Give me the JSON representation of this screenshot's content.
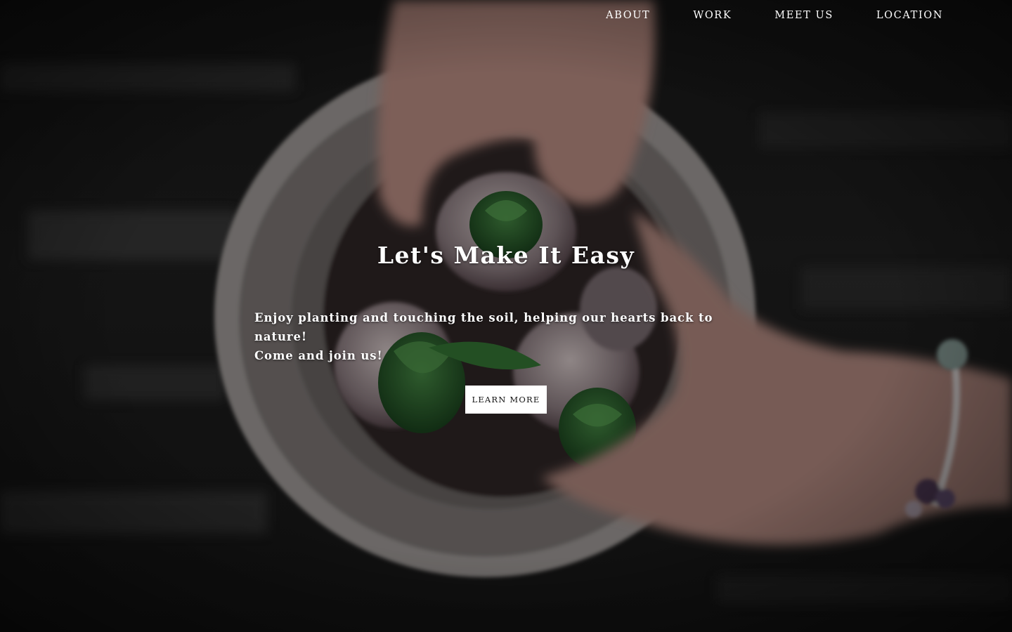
{
  "nav": {
    "items": [
      {
        "label": "ABOUT"
      },
      {
        "label": "WORK"
      },
      {
        "label": "MEET US"
      },
      {
        "label": "LOCATION"
      }
    ]
  },
  "hero": {
    "title": "Let's Make It Easy",
    "line1": "Enjoy planting and touching the soil, helping our hearts back to nature!",
    "line2": "Come and join us!",
    "cta_label": "LEARN MORE",
    "background_image": "hands-holding-potted-bulbs-photo"
  },
  "colors": {
    "text": "#ffffff",
    "button_bg": "#ffffff",
    "button_text": "#111111"
  }
}
